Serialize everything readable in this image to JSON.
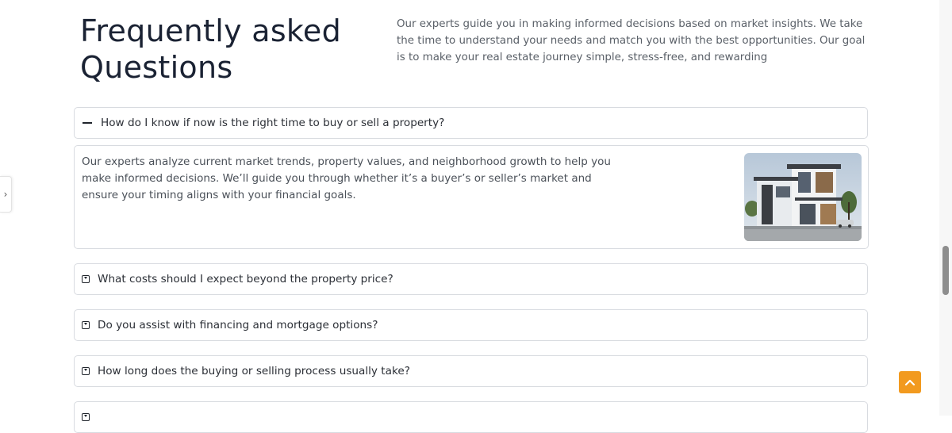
{
  "faq": {
    "title": "Frequently asked Questions",
    "intro": "Our experts guide you in making informed decisions based on market insights. We take the time to understand your needs and match you with the best opportunities. Our goal is to make your real estate journey simple, stress-free, and rewarding",
    "items": [
      {
        "question": "How do I know if now is the right time to buy or sell a property?",
        "expanded": true,
        "answer": "Our experts analyze current market trends, property values, and neighborhood growth to help you make informed decisions. We’ll guide you through whether it’s a buyer’s or seller’s market and ensure your timing aligns with your financial goals."
      },
      {
        "question": "What costs should I expect beyond the property price?",
        "expanded": false
      },
      {
        "question": "Do you assist with financing and mortgage options?",
        "expanded": false
      },
      {
        "question": "How long does the buying or selling process usually take?",
        "expanded": false
      },
      {
        "question": "",
        "expanded": false
      }
    ]
  },
  "colors": {
    "accent": "#f29a1f",
    "heading": "#1a2233",
    "border": "#d8dbe0"
  },
  "icons": {
    "collapse": "minus-icon",
    "expand": "caret-square-down-icon",
    "side_tab": "chevron-right-icon",
    "back_to_top": "chevron-up-icon"
  }
}
